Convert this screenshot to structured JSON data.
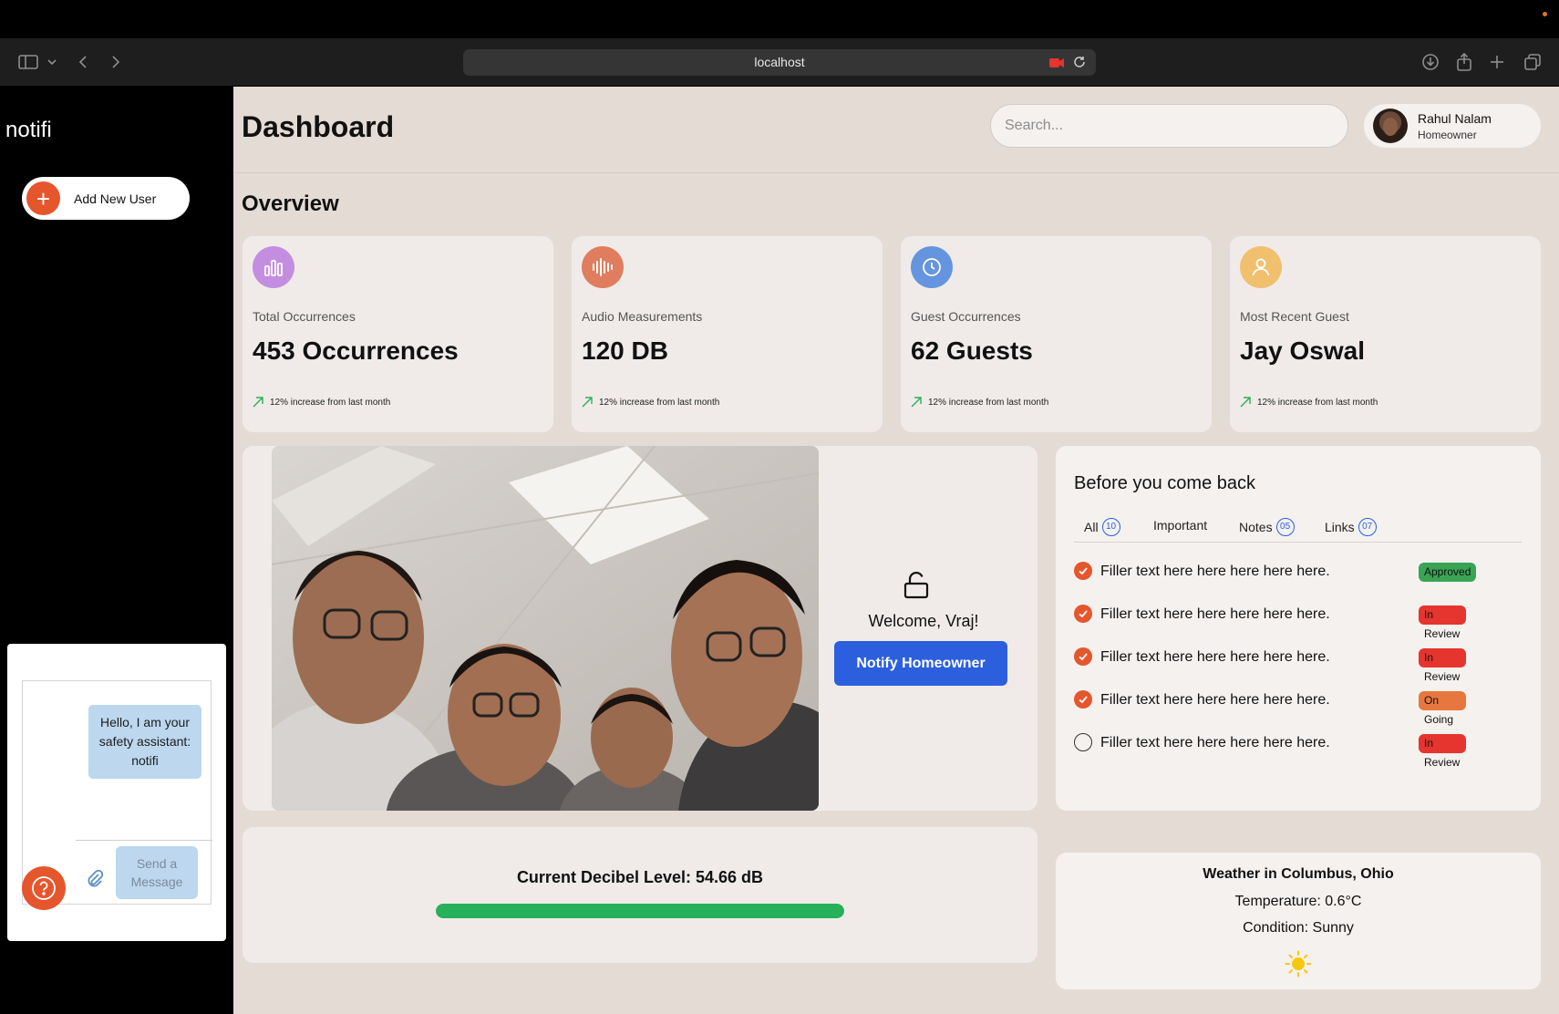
{
  "browser": {
    "url": "localhost"
  },
  "sidebar": {
    "brand": "notifi",
    "add_user_label": "Add New User",
    "chat": {
      "message": "Hello, I am your safety assistant: notifi",
      "send_label": "Send a Message"
    }
  },
  "header": {
    "title": "Dashboard",
    "search_placeholder": "Search...",
    "user": {
      "name": "Rahul Nalam",
      "role": "Homeowner"
    }
  },
  "overview": {
    "title": "Overview",
    "stats": [
      {
        "label": "Total Occurrences",
        "value": "453 Occurrences",
        "trend": "12% increase from last month",
        "icon": "bar-chart-icon",
        "color": "#c38ee0"
      },
      {
        "label": "Audio Measurements",
        "value": "120 DB",
        "trend": "12% increase from last month",
        "icon": "soundwave-icon",
        "color": "#e07d5e"
      },
      {
        "label": "Guest Occurrences",
        "value": "62 Guests",
        "trend": "12% increase from last month",
        "icon": "clock-icon",
        "color": "#6495de"
      },
      {
        "label": "Most Recent Guest",
        "value": "Jay Oswal",
        "trend": "12% increase from last month",
        "icon": "user-icon",
        "color": "#f0c06e"
      }
    ]
  },
  "camera": {
    "welcome": "Welcome, Vraj!",
    "notify_label": "Notify Homeowner",
    "icon": "unlock-icon"
  },
  "before_back": {
    "title": "Before you come back",
    "tabs": [
      {
        "label": "All",
        "count": "10"
      },
      {
        "label": "Important",
        "count": ""
      },
      {
        "label": "Notes",
        "count": "05"
      },
      {
        "label": "Links",
        "count": "07"
      }
    ],
    "tasks": [
      {
        "text": "Filler text here here here here here.",
        "status": "Approved",
        "done": true,
        "color": "#3aa354"
      },
      {
        "text": "Filler text here here here here here.",
        "status": "In Review",
        "done": true,
        "color": "#e5352e"
      },
      {
        "text": "Filler text here here here here here.",
        "status": "In Review",
        "done": true,
        "color": "#e5352e"
      },
      {
        "text": "Filler text here here here here here.",
        "status": "On Going",
        "done": true,
        "color": "#e7773e"
      },
      {
        "text": "Filler text here here here here here.",
        "status": "In Review",
        "done": false,
        "color": "#e5352e"
      }
    ]
  },
  "decibel": {
    "label": "Current Decibel Level: 54.66 dB",
    "level_percent": 100,
    "color": "#27b05a"
  },
  "weather": {
    "title": "Weather in Columbus, Ohio",
    "temperature": "Temperature: 0.6°C",
    "condition": "Condition: Sunny",
    "icon": "sun-icon"
  }
}
